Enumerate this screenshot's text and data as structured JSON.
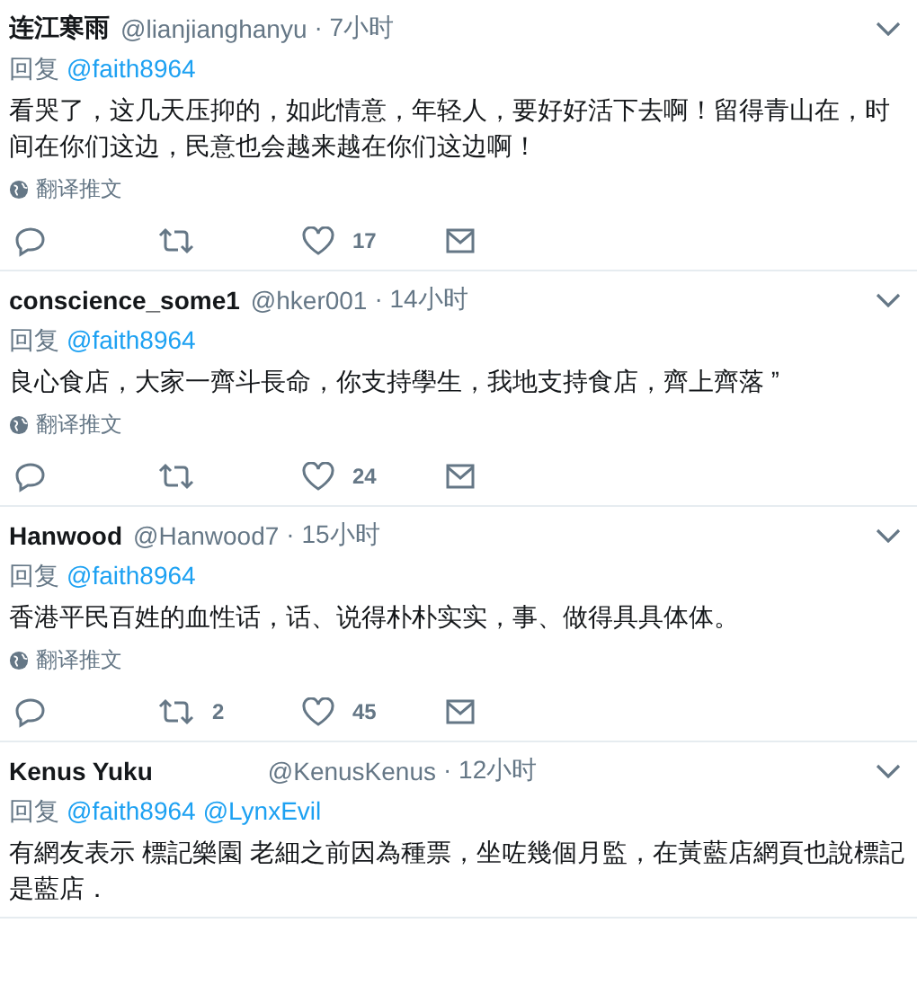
{
  "tweets": [
    {
      "name": "连江寒雨",
      "handle": "@lianjianghanyu",
      "time": "· 7小时",
      "reply_label": "回复",
      "mentions": [
        "@faith8964"
      ],
      "text": "看哭了，这几天压抑的，如此情意，年轻人，要好好活下去啊！留得青山在，时间在你们这边，民意也会越来越在你们这边啊！",
      "translate": "翻译推文",
      "likes": "17"
    },
    {
      "name": "conscience_some1",
      "handle": "@hker001",
      "time": "· 14小时",
      "reply_label": "回复",
      "mentions": [
        "@faith8964"
      ],
      "text": "良心食店，大家一齊斗長命，你支持學生，我地支持食店，齊上齊落  ˮ",
      "translate": "翻译推文",
      "likes": "24"
    },
    {
      "name": "Hanwood",
      "handle": "@Hanwood7",
      "time": "· 15小时",
      "reply_label": "回复",
      "mentions": [
        "@faith8964"
      ],
      "text": "香港平民百姓的血性话，话、说得朴朴实实，事、做得具具体体。",
      "translate": "翻译推文",
      "retweets": "2",
      "likes": "45"
    },
    {
      "name": "Kenus Yuku",
      "handle": "@KenusKenus",
      "time": "· 12小时",
      "reply_label": "回复",
      "mentions": [
        "@faith8964",
        "@LynxEvil"
      ],
      "text": "有網友表示 標記樂園 老細之前因為種票，坐咗幾個月監，在黃藍店網頁也說標記是藍店．"
    }
  ]
}
